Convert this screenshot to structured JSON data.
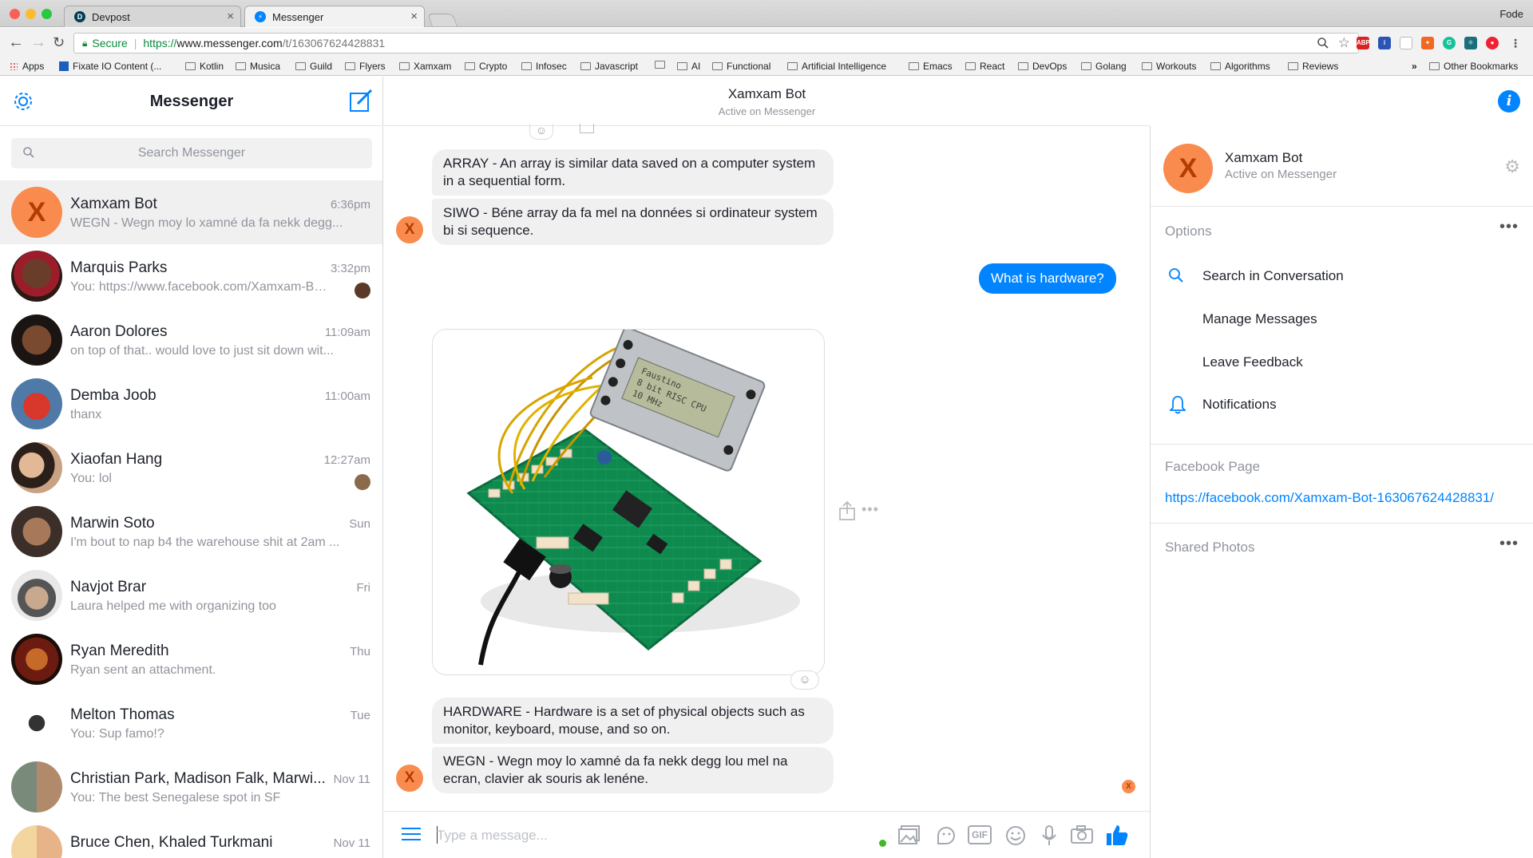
{
  "browser": {
    "tabs": [
      {
        "title": "Devpost",
        "favicon": "D"
      },
      {
        "title": "Messenger",
        "favicon": "messenger-icon"
      }
    ],
    "profile": "Fode",
    "url": {
      "secure_label": "Secure",
      "scheme": "https://",
      "host": "www.messenger.com",
      "path": "/t/163067624428831"
    },
    "bookmarks": [
      "Apps",
      "Fixate IO Content (...",
      "Kotlin",
      "Musica",
      "Guild",
      "Flyers",
      "Xamxam",
      "Crypto",
      "Infosec",
      "Javascript",
      "",
      "AI",
      "Functional",
      "Artificial Intelligence",
      "Emacs",
      "React",
      "DevOps",
      "Golang",
      "Workouts",
      "Algorithms",
      "Reviews"
    ],
    "other_bookmarks": "Other Bookmarks",
    "overflow": "»"
  },
  "sidebar": {
    "title": "Messenger",
    "search_placeholder": "Search Messenger",
    "conversations": [
      {
        "name": "Xamxam Bot",
        "time": "6:36pm",
        "preview": "WEGN - Wegn moy lo xamné da fa nekk degg...",
        "avatar": "X"
      },
      {
        "name": "Marquis Parks",
        "time": "3:32pm",
        "preview": "You: https://www.facebook.com/Xamxam-Bot..."
      },
      {
        "name": "Aaron Dolores",
        "time": "11:09am",
        "preview": "on top of that.. would love to just sit down wit..."
      },
      {
        "name": "Demba Joob",
        "time": "11:00am",
        "preview": "thanx"
      },
      {
        "name": "Xiaofan Hang",
        "time": "12:27am",
        "preview": "You: lol"
      },
      {
        "name": "Marwin Soto",
        "time": "Sun",
        "preview": "I'm bout to nap b4 the warehouse shit at 2am ..."
      },
      {
        "name": "Navjot Brar",
        "time": "Fri",
        "preview": "Laura helped me with organizing too"
      },
      {
        "name": "Ryan Meredith",
        "time": "Thu",
        "preview": "Ryan sent an attachment."
      },
      {
        "name": "Melton Thomas",
        "time": "Tue",
        "preview": "You: Sup famo!?"
      },
      {
        "name": "Christian Park, Madison Falk, Marwi...",
        "time": "Nov 11",
        "preview": "You: The best Senegalese spot in SF"
      },
      {
        "name": "Bruce Chen, Khaled Turkmani",
        "time": "Nov 11",
        "preview": ""
      }
    ]
  },
  "chat": {
    "name": "Xamxam Bot",
    "status": "Active on Messenger",
    "messages": [
      {
        "from": "bot",
        "text": "ARRAY - An array is similar data saved on a computer system in a sequential form."
      },
      {
        "from": "bot",
        "text": "SIWO - Béne array da fa mel na données si ordinateur system bi si sequence."
      },
      {
        "from": "me",
        "text": "What is hardware?"
      },
      {
        "from": "bot",
        "type": "image",
        "lcd_text": [
          "Faustino",
          "8 bit RISC CPU",
          "10 MHz"
        ]
      },
      {
        "from": "bot",
        "text": "HARDWARE - Hardware is a set of physical objects such as monitor, keyboard, mouse, and so on."
      },
      {
        "from": "bot",
        "text": "WEGN - Wegn moy lo xamné da fa nekk degg lou mel na ecran, clavier ak souris ak lenéne."
      }
    ],
    "avatar_letter": "X",
    "composer_placeholder": "Type a message...",
    "gif_label": "GIF"
  },
  "details": {
    "name": "Xamxam Bot",
    "status": "Active on Messenger",
    "options_header": "Options",
    "options": [
      "Search in Conversation",
      "Manage Messages",
      "Leave Feedback",
      "Notifications"
    ],
    "facebook_header": "Facebook Page",
    "facebook_link": "https://facebook.com/Xamxam-Bot-163067624428831/",
    "shared_photos_header": "Shared Photos"
  },
  "colors": {
    "accent": "#0084ff",
    "bot_avatar": "#f98b4f",
    "bubble_gray": "#f1f0f0"
  }
}
